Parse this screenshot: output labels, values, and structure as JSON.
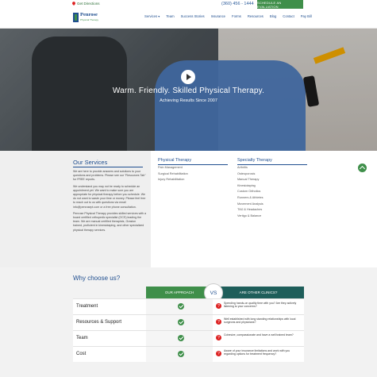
{
  "topbar": {
    "directions": "Get Directions",
    "phone": "(360) 456 - 1444",
    "cta": "SCHEDULE AN EVALUATION"
  },
  "logo": {
    "name": "Penrose",
    "tagline": "Physical Therapy"
  },
  "nav": {
    "items": [
      "Services",
      "Team",
      "Success Stories",
      "Insurance",
      "Forms",
      "Resources",
      "Blog",
      "Contact",
      "Pay Bill"
    ]
  },
  "hero": {
    "title": "Warm. Friendly. Skilled Physical Therapy.",
    "subtitle": "Achieving Results Since 2007"
  },
  "services": {
    "title": "Our Services",
    "p1": "We are here to provide answers and solutions to your questions and problems. Please see our \"Resources Tab\" for FREE reports.",
    "p2": "We understand you may not be ready to schedule an appointment yet. We want to make sure you are appropriate for physical therapy before you schedule. We do not want to waste your time or money. Please feel free to reach out to us with questions via email info@penrosept.com or a free phone consultation.",
    "p3": "Penrose Physical Therapy provides skilled services with a board certified orthopedic specialist (OCS) leading the team. We are manual certified therapists, Graston trained, proficient in kinesiotaping, and other specialized physical therapy services.",
    "pt": {
      "title": "Physical Therapy",
      "items": [
        "Pain Management",
        "Surgical Rehabilitation",
        "Injury Rehabilitation"
      ]
    },
    "specialty": {
      "title": "Specialty Therapy",
      "items": [
        "Arthritis",
        "Osteoporosis",
        "Manual Therapy",
        "Kinesiotaping",
        "Custom Orthotics",
        "Runners & Athletes",
        "Movement Analysis",
        "TMJ & Headaches",
        "Vertigo & Balance"
      ]
    }
  },
  "why": {
    "title": "Why choose us?",
    "our_approach": "OUR APPROACH",
    "vs": "VS",
    "other_clinics": "ARE OTHER CLINICS?",
    "rows": [
      {
        "label": "Treatment",
        "question": "Spending hands-on quality time with you? Are they actively listening to your concerns?"
      },
      {
        "label": "Resources & Support",
        "question": "Well established with long standing relationships with local surgeons and physicians?"
      },
      {
        "label": "Team",
        "question": "Cohesive, compassionate and have a well trained team?"
      },
      {
        "label": "Cost",
        "question": "Aware of your insurance limitations and work with you regarding options for treatment frequency?"
      }
    ]
  },
  "colors": {
    "brand_blue": "#1f4e8f",
    "brand_green": "#3f8f4a",
    "teal": "#1e5e5a",
    "red": "#dd2222"
  },
  "icons": [
    "map-pin-icon",
    "play-icon",
    "arrow-up-icon",
    "check-icon",
    "question-icon",
    "chevron-down-icon"
  ]
}
